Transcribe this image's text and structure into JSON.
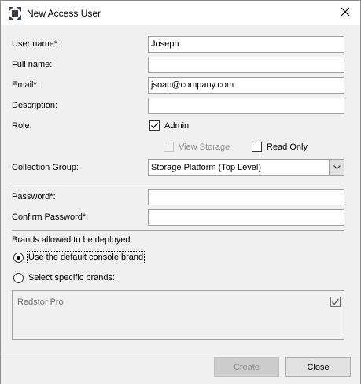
{
  "window": {
    "title": "New Access User"
  },
  "form": {
    "username": {
      "label": "User name*:",
      "value": "Joseph"
    },
    "fullname": {
      "label": "Full name:",
      "value": ""
    },
    "email": {
      "label": "Email*:",
      "value": "jsoap@company.com"
    },
    "description": {
      "label": "Description:",
      "value": ""
    },
    "role": {
      "label": "Role:",
      "admin": {
        "label": "Admin",
        "checked": true
      },
      "view_storage": {
        "label": "View Storage",
        "checked": false,
        "disabled": true
      },
      "read_only": {
        "label": "Read Only",
        "checked": false
      }
    },
    "collection_group": {
      "label": "Collection Group:",
      "value": "Storage Platform (Top Level)"
    },
    "password": {
      "label": "Password*:",
      "value": ""
    },
    "confirm_password": {
      "label": "Confirm Password*:",
      "value": ""
    }
  },
  "brands": {
    "heading": "Brands allowed to be deployed:",
    "default_option": "Use the default console brand",
    "specific_option": "Select specific brands:",
    "selected": "default",
    "list": [
      {
        "name": "Redstor Pro",
        "checked": true
      }
    ]
  },
  "footer": {
    "create_label": "Create",
    "close_label": "Close"
  }
}
